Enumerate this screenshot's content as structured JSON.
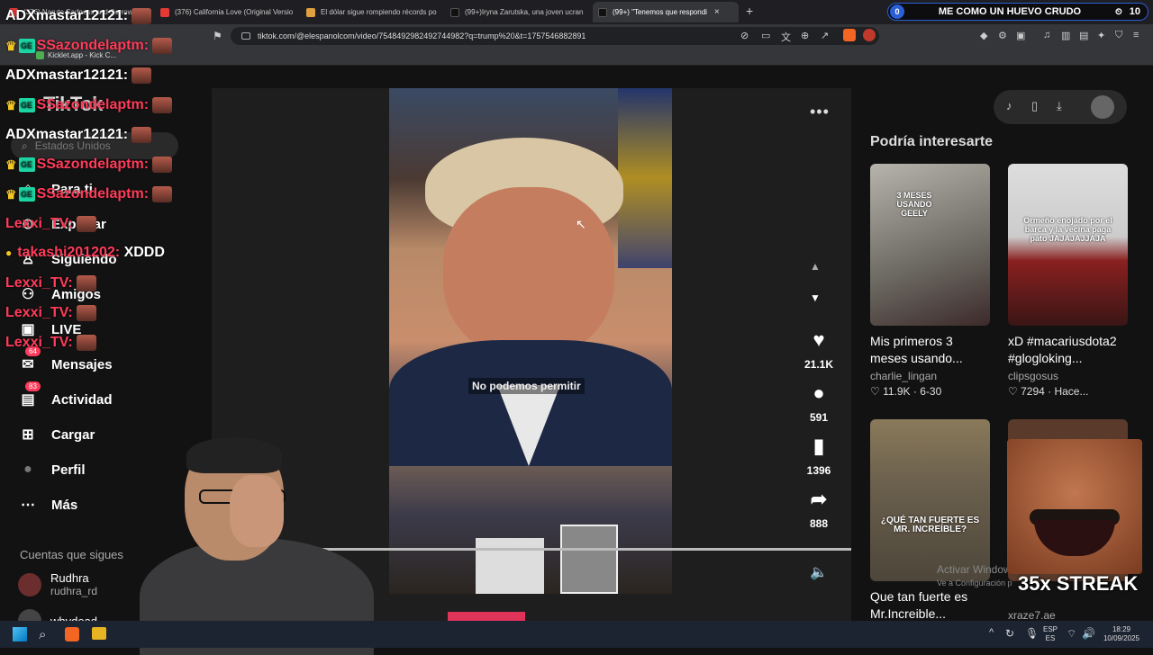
{
  "browser": {
    "tabs": [
      {
        "title": "(376) Naruto Sadness and Sorrow",
        "favcolor": "#e53935"
      },
      {
        "title": "(376) California Love (Original Versio",
        "favcolor": "#e53935"
      },
      {
        "title": "El dólar sigue rompiendo récords po",
        "favcolor": "#e0a040"
      },
      {
        "title": "(99+)Iryna Zarutska, una joven ucran",
        "favcolor": "#111111"
      },
      {
        "title": "(99+)",
        "favcolor": "#111111"
      },
      {
        "title": "\"Tenemos que respondi",
        "favcolor": "#7b61ff"
      }
    ],
    "new_tab": "+",
    "notification": {
      "left": "0",
      "title": "ME COMO UN HUEVO CRUDO",
      "right": "10",
      "timer_icon": "⏲"
    },
    "url": "tiktok.com/@elespanolcom/video/7548492982492744982?q=trump%20&t=1757546882891",
    "bookmark": "Kicklet.app - Kick C..."
  },
  "tiktok": {
    "logo": "TikTok",
    "search_placeholder": "Estados Unidos",
    "nav": [
      {
        "label": "Para ti",
        "icon": "⌂"
      },
      {
        "label": "Explorar",
        "icon": "⊙"
      },
      {
        "label": "Siguiendo",
        "icon": "♙"
      },
      {
        "label": "Amigos",
        "icon": "⚇"
      },
      {
        "label": "LIVE",
        "icon": "▣"
      },
      {
        "label": "Mensajes",
        "icon": "✉",
        "badge": "64"
      },
      {
        "label": "Actividad",
        "icon": "▤",
        "badge": "83"
      },
      {
        "label": "Cargar",
        "icon": "⊞"
      },
      {
        "label": "Perfil",
        "icon": "●"
      },
      {
        "label": "Más",
        "icon": "⋯"
      }
    ],
    "following_header": "Cuentas que sigues",
    "following": [
      {
        "name": "Rudhra",
        "handle": "rudhra_rd"
      },
      {
        "name": "whydead",
        "handle": ""
      }
    ],
    "video": {
      "caption": "No podemos permitir",
      "more": "•••",
      "likes": "21.1K",
      "comments": "591",
      "saves": "1396",
      "shares": "888"
    },
    "suggest_header": "Podría interesarte",
    "cards": [
      {
        "title": "Mis primeros 3 meses usando...",
        "user": "charlie_lingan",
        "likes": "11.9K",
        "date": "6-30",
        "thumb_text": "3 MESES USANDO GEELY"
      },
      {
        "title": "xD #macariusdota2 #glogloking...",
        "user": "clipsgosus",
        "likes": "7294",
        "date": "Hace...",
        "thumb_text": "Ormeño enojado por el barca y la vecina paga pato JAJAJAJJAJA"
      },
      {
        "title": "Que tan fuerte es Mr.Increible...",
        "user": "",
        "likes": "",
        "date": "",
        "thumb_text": "¿QUÉ TAN FUERTE ES MR. INCREÍBLE?"
      },
      {
        "title": "",
        "user": "xraze7.ae",
        "likes": "",
        "date": "",
        "thumb_text": ""
      }
    ]
  },
  "stream_overlay": {
    "chat": [
      {
        "user": "ADXmastar12121:",
        "color": "#ffffff",
        "msg": "",
        "badges": false
      },
      {
        "user": "SSazondelaptm:",
        "color": "#ff3c5a",
        "msg": "",
        "badges": true
      },
      {
        "user": "ADXmastar12121:",
        "color": "#ffffff",
        "msg": "",
        "badges": false
      },
      {
        "user": "SSazondelaptm:",
        "color": "#ff3c5a",
        "msg": "",
        "badges": true
      },
      {
        "user": "ADXmastar12121:",
        "color": "#ffffff",
        "msg": "",
        "badges": false
      },
      {
        "user": "SSazondelaptm:",
        "color": "#ff3c5a",
        "msg": "",
        "badges": true
      },
      {
        "user": "SSazondelaptm:",
        "color": "#ff3c5a",
        "msg": "",
        "badges": true
      },
      {
        "user": "Lexxi_TV:",
        "color": "#ff3c5a",
        "msg": "",
        "badges": false
      },
      {
        "user": "takashi201202:",
        "color": "#ff3c5a",
        "msg": "XDDD",
        "badges": false
      },
      {
        "user": "Lexxi_TV:",
        "color": "#ff3c5a",
        "msg": "",
        "badges": false
      },
      {
        "user": "Lexxi_TV:",
        "color": "#ff3c5a",
        "msg": "",
        "badges": false
      },
      {
        "user": "Lexxi_TV:",
        "color": "#ff3c5a",
        "msg": "",
        "badges": false
      }
    ],
    "streak": "35x STREAK",
    "windows_watermark": {
      "line1": "Activar Windows",
      "line2": "Ve a Configuración p"
    }
  },
  "taskbar": {
    "lang": "ESP",
    "lang2": "ES",
    "time": "18:29",
    "date": "10/09/2025"
  }
}
